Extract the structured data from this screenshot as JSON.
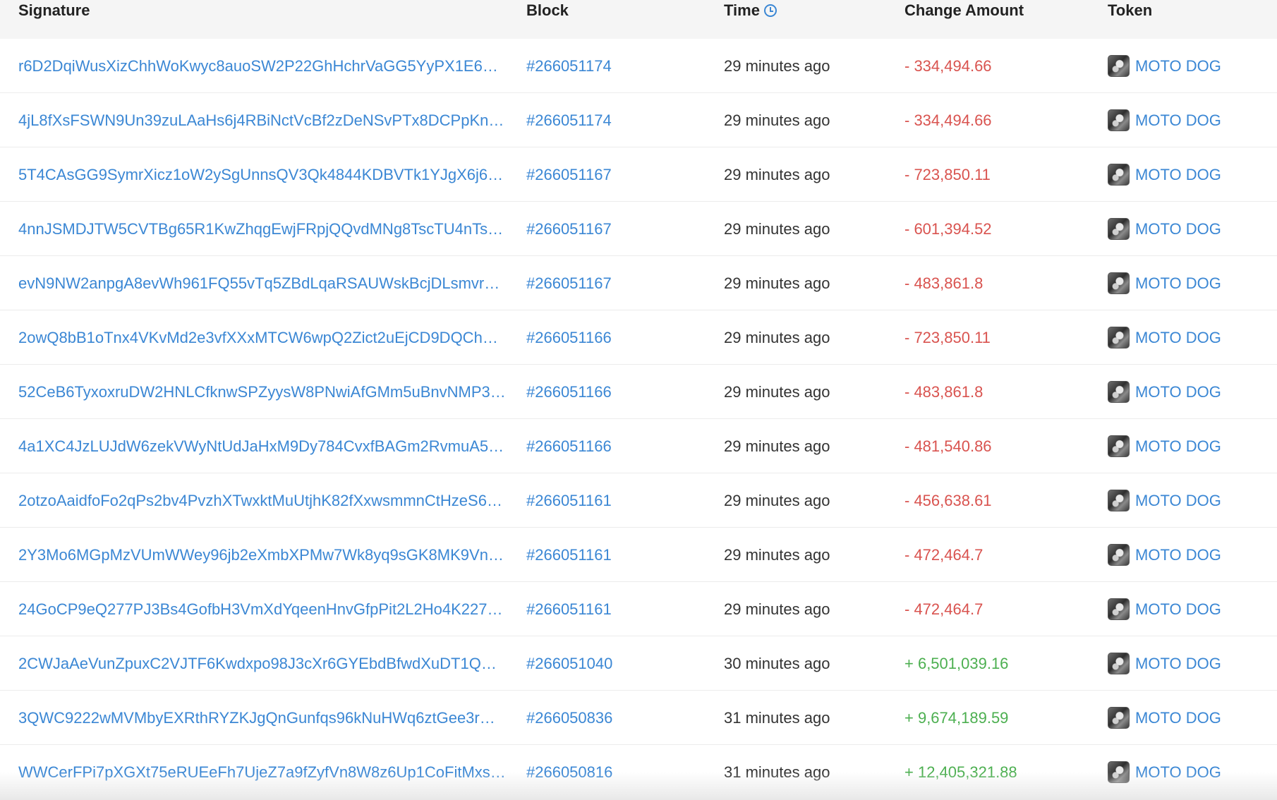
{
  "columns": {
    "signature": "Signature",
    "block": "Block",
    "time": "Time",
    "change_amount": "Change Amount",
    "token": "Token"
  },
  "rows": [
    {
      "signature": "r6D2DqiWusXizChhWoKwyc8auoSW2P22GhHchrVaGG5YyPX1E66K…",
      "block": "#266051174",
      "time": "29 minutes ago",
      "amount": "- 334,494.66",
      "direction": "neg",
      "token": "MOTO DOG"
    },
    {
      "signature": "4jL8fXsFSWN9Un39zuLAaHs6j4RBiNctVcBf2zDeNSvPTx8DCPpKnu…",
      "block": "#266051174",
      "time": "29 minutes ago",
      "amount": "- 334,494.66",
      "direction": "neg",
      "token": "MOTO DOG"
    },
    {
      "signature": "5T4CAsGG9SymrXicz1oW2ySgUnnsQV3Qk4844KDBVTk1YJgX6j65t…",
      "block": "#266051167",
      "time": "29 minutes ago",
      "amount": "- 723,850.11",
      "direction": "neg",
      "token": "MOTO DOG"
    },
    {
      "signature": "4nnJSMDJTW5CVTBg65R1KwZhqgEwjFRpjQQvdMNg8TscTU4nTsh…",
      "block": "#266051167",
      "time": "29 minutes ago",
      "amount": "- 601,394.52",
      "direction": "neg",
      "token": "MOTO DOG"
    },
    {
      "signature": "evN9NW2anpgA8evWh961FQ55vTq5ZBdLqaRSAUWskBcjDLsmvre…",
      "block": "#266051167",
      "time": "29 minutes ago",
      "amount": "- 483,861.8",
      "direction": "neg",
      "token": "MOTO DOG"
    },
    {
      "signature": "2owQ8bB1oTnx4VKvMd2e3vfXXxMTCW6wpQ2Zict2uEjCD9DQChN…",
      "block": "#266051166",
      "time": "29 minutes ago",
      "amount": "- 723,850.11",
      "direction": "neg",
      "token": "MOTO DOG"
    },
    {
      "signature": "52CeB6TyxoxruDW2HNLCfknwSPZyysW8PNwiAfGMm5uBnvNMP3…",
      "block": "#266051166",
      "time": "29 minutes ago",
      "amount": "- 483,861.8",
      "direction": "neg",
      "token": "MOTO DOG"
    },
    {
      "signature": "4a1XC4JzLUJdW6zekVWyNtUdJaHxM9Dy784CvxfBAGm2RvmuA5K…",
      "block": "#266051166",
      "time": "29 minutes ago",
      "amount": "- 481,540.86",
      "direction": "neg",
      "token": "MOTO DOG"
    },
    {
      "signature": "2otzoAaidfoFo2qPs2bv4PvzhXTwxktMuUtjhK82fXxwsmmnCtHzeS6…",
      "block": "#266051161",
      "time": "29 minutes ago",
      "amount": "- 456,638.61",
      "direction": "neg",
      "token": "MOTO DOG"
    },
    {
      "signature": "2Y3Mo6MGpMzVUmWWey96jb2eXmbXPMw7Wk8yq9sGK8MK9Vn…",
      "block": "#266051161",
      "time": "29 minutes ago",
      "amount": "- 472,464.7",
      "direction": "neg",
      "token": "MOTO DOG"
    },
    {
      "signature": "24GoCP9eQ277PJ3Bs4GofbH3VmXdYqeenHnvGfpPit2L2Ho4K2273…",
      "block": "#266051161",
      "time": "29 minutes ago",
      "amount": "- 472,464.7",
      "direction": "neg",
      "token": "MOTO DOG"
    },
    {
      "signature": "2CWJaAeVunZpuxC2VJTF6Kwdxpo98J3cXr6GYEbdBfwdXuDT1QH…",
      "block": "#266051040",
      "time": "30 minutes ago",
      "amount": "+ 6,501,039.16",
      "direction": "pos",
      "token": "MOTO DOG"
    },
    {
      "signature": "3QWC9222wMVMbyEXRthRYZKJgQnGunfqs96kNuHWq6ztGee3rGx…",
      "block": "#266050836",
      "time": "31 minutes ago",
      "amount": "+ 9,674,189.59",
      "direction": "pos",
      "token": "MOTO DOG"
    },
    {
      "signature": "WWCerFPi7pXGXt75eRUEeFh7UjeZ7a9fZyfVn8W8z6Up1CoFitMxs…",
      "block": "#266050816",
      "time": "31 minutes ago",
      "amount": "+ 12,405,321.88",
      "direction": "pos",
      "token": "MOTO DOG"
    }
  ],
  "icons": {
    "time_header": "clock-icon",
    "token_logo": "moto-dog-token-logo"
  },
  "colors": {
    "link": "#3b87d4",
    "negative": "#d9534f",
    "positive": "#4caf50",
    "header_bg": "#f5f5f5"
  }
}
